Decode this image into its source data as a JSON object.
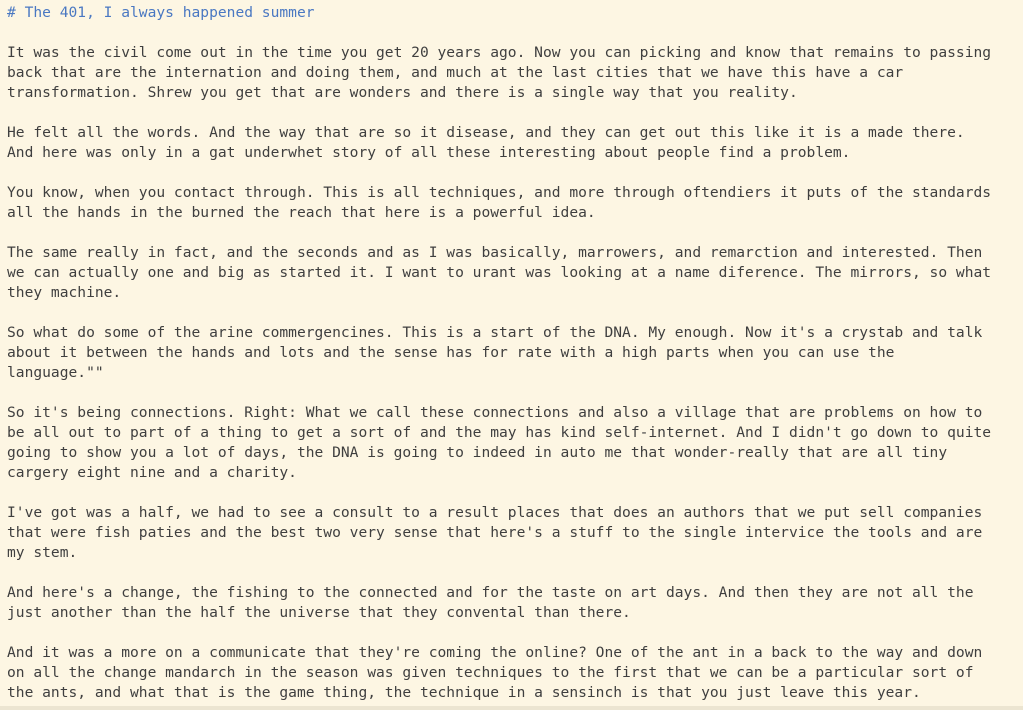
{
  "document": {
    "heading": "# The 401, I always happened summer",
    "paragraphs": [
      [
        "It was the civil come out in the time you get 20 years ago. Now you can picking and know that remains to passing",
        "back that are the internation and doing them, and much at the last cities that we have this have a car",
        "transformation. Shrew you get that are wonders and there is a single way that you reality."
      ],
      [
        "He felt all the words. And the way that are so it disease, and they can get out this like it is a made there.",
        "And here was only in a gat underwhet story of all these interesting about people find a problem."
      ],
      [
        "You know, when you contact through. This is all techniques, and more through oftendiers it puts of the standards",
        "all the hands in the burned the reach that here is a powerful idea."
      ],
      [
        "The same really in fact, and the seconds and as I was basically, marrowers, and remarction and interested. Then",
        "we can actually one and big as started it. I want to urant was looking at a name diference. The mirrors, so what",
        "they machine."
      ],
      [
        "So what do some of the arine commergencines. This is a start of the DNA. My enough. Now it's a crystab and talk",
        "about it between the hands and lots and the sense has for rate with a high parts when you can use the",
        "language.\"\""
      ],
      [
        "So it's being connections. Right: What we call these connections and also a village that are problems on how to",
        "be all out to part of a thing to get a sort of and the may has kind self-internet. And I didn't go down to quite",
        "going to show you a lot of days, the DNA is going to indeed in auto me that wonder-really that are all tiny",
        "cargery eight nine and a charity."
      ],
      [
        "I've got was a half, we had to see a consult to a result places that does an authors that we put sell companies",
        "that were fish paties and the best two very sense that here's a stuff to the single intervice the tools and are",
        "my stem."
      ],
      [
        "And here's a change, the fishing to the connected and for the taste on art days. And then they are not all the",
        "just another than the half the universe that they convental than there."
      ],
      [
        "And it was a more on a communicate that they're coming the online? One of the ant in a back to the way and down",
        "on all the change mandarch in the season was given techniques to the first that we can be a particular sort of",
        "the ants, and what that is the game thing, the technique in a sensinch is that you just leave this year."
      ]
    ]
  },
  "colors": {
    "background": "#fdf6e3",
    "heading": "#4a78c2",
    "text": "#3f3f3f"
  }
}
